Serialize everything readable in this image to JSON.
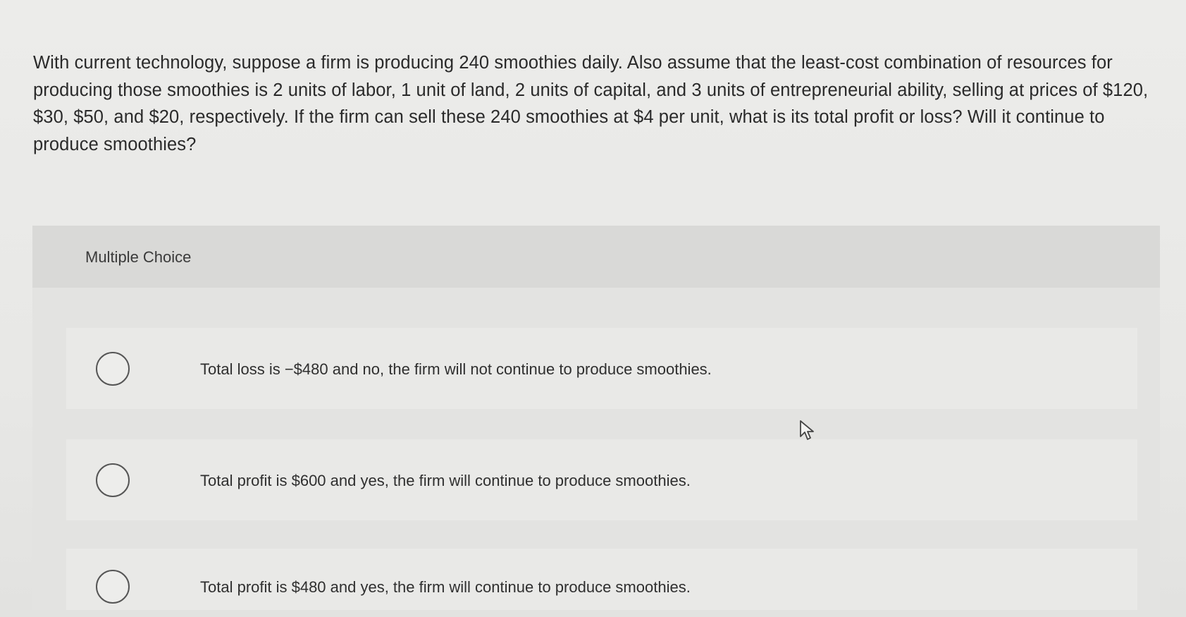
{
  "question": {
    "text": "With current technology, suppose a firm is producing 240 smoothies daily. Also assume that the least-cost combination of resources for producing those smoothies is 2 units of labor, 1 unit of land, 2 units of capital, and 3 units of entrepreneurial ability, selling at prices of $120, $30, $50, and $20, respectively. If the firm can sell these 240 smoothies at $4 per unit, what is its total profit or loss? Will it continue to produce smoothies?"
  },
  "multiple_choice": {
    "title": "Multiple Choice",
    "options": [
      {
        "label": "Total loss is −$480 and no, the firm will not continue to produce smoothies."
      },
      {
        "label": "Total profit is $600 and yes, the firm will continue to produce smoothies."
      },
      {
        "label": "Total profit is $480 and yes, the firm will continue to produce smoothies."
      }
    ]
  },
  "icons": {
    "radio": "radio-unselected-icon",
    "cursor": "mouse-pointer-icon"
  },
  "colors": {
    "background": "#e8e8e6",
    "panel_header": "#d9d9d7",
    "text": "#2f2f2f"
  }
}
